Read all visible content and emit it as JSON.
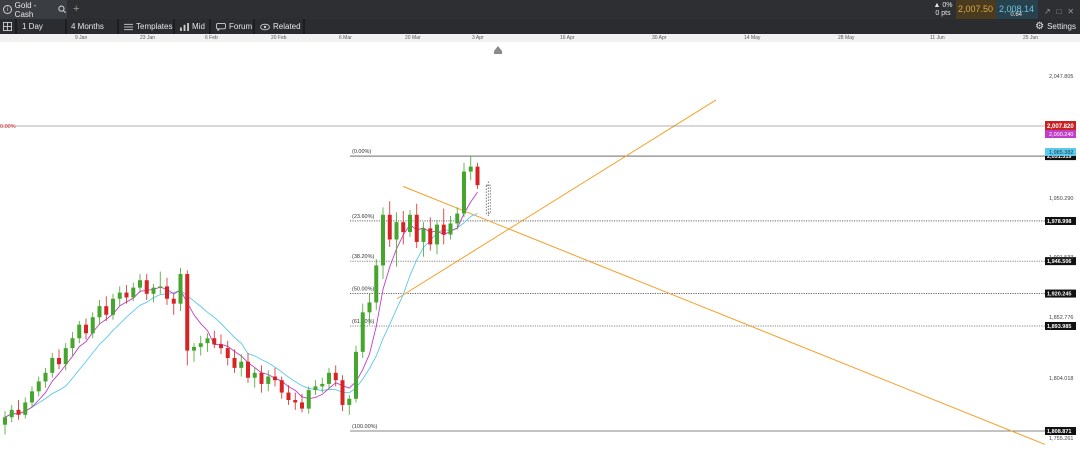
{
  "header": {
    "instrument_tab": "Gold - Cash",
    "icons": {
      "instrument": "info-circle-icon",
      "search": "search-icon",
      "add_tab": "plus-icon",
      "settings": "gear-icon"
    }
  },
  "quote": {
    "change_label": "▲ 0%",
    "change_points": "0 pts",
    "bid": "2,007.50",
    "spread": "0.64",
    "ask": "2,008.14",
    "colors": {
      "bid": "#d9a84a",
      "ask": "#6fc3e0"
    }
  },
  "toolbar": {
    "interval": "1 Day",
    "period": "4 Months",
    "templates": "Templates",
    "mid": "Mid",
    "forum": "Forum",
    "related": "Related",
    "settings": "Settings"
  },
  "time_axis": [
    "9 Jan",
    "23 Jan",
    "6 Feb",
    "20 Feb",
    "6 Mar",
    "20 Mar",
    "3 Apr",
    "16 Apr",
    "30 Apr",
    "14 May",
    "28 May",
    "11 Jun",
    "25 Jun"
  ],
  "chart_data": {
    "type": "candlestick",
    "instrument": "Gold - Cash",
    "interval": "1 Day",
    "y_axis_ticks": [
      "2,047.805",
      "1,950.290",
      "1,901.533",
      "1,852.776",
      "1,804.018",
      "1,755.261"
    ],
    "fib_labels": [
      "(0.00%)",
      "(23.60%)",
      "(38.20%)",
      "(50.00%)",
      "(61.80%)",
      "(100.00%)"
    ],
    "fib_badges": [
      "2,031.519",
      "1,978.998",
      "1,946.506",
      "1,920.245",
      "1,893.985",
      "1,808.871"
    ],
    "current_price": "2,007.820",
    "ma_price_1": "2,000.240",
    "ma_price_2": "1,985.382",
    "left_stub_label": "0.00%",
    "colors": {
      "up": "#45a52c",
      "down": "#d62424",
      "ma_fast": "#c03fc8",
      "ma_slow": "#5bc8ec",
      "trendline": "#f4a028"
    },
    "candles": [
      [
        1814,
        1825,
        1806,
        1820
      ],
      [
        1820,
        1830,
        1816,
        1826
      ],
      [
        1826,
        1834,
        1818,
        1822
      ],
      [
        1822,
        1836,
        1819,
        1832
      ],
      [
        1832,
        1845,
        1828,
        1841
      ],
      [
        1841,
        1853,
        1837,
        1849
      ],
      [
        1849,
        1860,
        1844,
        1856
      ],
      [
        1856,
        1872,
        1852,
        1868
      ],
      [
        1868,
        1875,
        1859,
        1863
      ],
      [
        1863,
        1880,
        1858,
        1876
      ],
      [
        1876,
        1889,
        1870,
        1884
      ],
      [
        1884,
        1898,
        1880,
        1895
      ],
      [
        1895,
        1900,
        1883,
        1888
      ],
      [
        1888,
        1905,
        1884,
        1901
      ],
      [
        1901,
        1915,
        1895,
        1910
      ],
      [
        1910,
        1918,
        1898,
        1903
      ],
      [
        1903,
        1920,
        1899,
        1916
      ],
      [
        1916,
        1926,
        1910,
        1921
      ],
      [
        1921,
        1927,
        1912,
        1917
      ],
      [
        1917,
        1929,
        1914,
        1925
      ],
      [
        1925,
        1936,
        1921,
        1931
      ],
      [
        1931,
        1936,
        1915,
        1920
      ],
      [
        1920,
        1928,
        1913,
        1925
      ],
      [
        1925,
        1938,
        1920,
        1926
      ],
      [
        1926,
        1933,
        1911,
        1916
      ],
      [
        1916,
        1920,
        1903,
        1912
      ],
      [
        1912,
        1941,
        1906,
        1936
      ],
      [
        1936,
        1939,
        1862,
        1874
      ],
      [
        1874,
        1880,
        1865,
        1877
      ],
      [
        1877,
        1886,
        1870,
        1880
      ],
      [
        1880,
        1888,
        1873,
        1884
      ],
      [
        1884,
        1890,
        1876,
        1879
      ],
      [
        1879,
        1887,
        1871,
        1876
      ],
      [
        1876,
        1882,
        1862,
        1868
      ],
      [
        1868,
        1875,
        1856,
        1860
      ],
      [
        1860,
        1871,
        1853,
        1865
      ],
      [
        1865,
        1872,
        1848,
        1852
      ],
      [
        1852,
        1860,
        1844,
        1856
      ],
      [
        1856,
        1862,
        1840,
        1847
      ],
      [
        1847,
        1858,
        1841,
        1853
      ],
      [
        1853,
        1860,
        1845,
        1850
      ],
      [
        1850,
        1853,
        1835,
        1840
      ],
      [
        1840,
        1846,
        1830,
        1834
      ],
      [
        1834,
        1840,
        1826,
        1832
      ],
      [
        1832,
        1839,
        1824,
        1827
      ],
      [
        1827,
        1845,
        1823,
        1842
      ],
      [
        1842,
        1850,
        1838,
        1845
      ],
      [
        1845,
        1852,
        1840,
        1847
      ],
      [
        1847,
        1860,
        1843,
        1856
      ],
      [
        1856,
        1862,
        1845,
        1850
      ],
      [
        1850,
        1854,
        1825,
        1830
      ],
      [
        1830,
        1838,
        1822,
        1835
      ],
      [
        1835,
        1878,
        1832,
        1873
      ],
      [
        1873,
        1912,
        1868,
        1905
      ],
      [
        1905,
        1920,
        1895,
        1913
      ],
      [
        1913,
        1948,
        1907,
        1943
      ],
      [
        1943,
        1990,
        1932,
        1984
      ],
      [
        1984,
        1995,
        1958,
        1964
      ],
      [
        1964,
        1986,
        1942,
        1978
      ],
      [
        1978,
        1987,
        1960,
        1970
      ],
      [
        1970,
        1988,
        1966,
        1984
      ],
      [
        1984,
        1993,
        1957,
        1962
      ],
      [
        1962,
        1978,
        1950,
        1973
      ],
      [
        1973,
        1982,
        1955,
        1960
      ],
      [
        1960,
        1980,
        1952,
        1976
      ],
      [
        1976,
        1989,
        1960,
        1968
      ],
      [
        1968,
        1983,
        1964,
        1977
      ],
      [
        1977,
        1990,
        1972,
        1985
      ],
      [
        1985,
        2026,
        1982,
        2019
      ],
      [
        2019,
        2031,
        2012,
        2023
      ],
      [
        2023,
        2026,
        2005,
        2008
      ]
    ],
    "forecast_candle": [
      2008,
      2011,
      1982,
      1985
    ]
  }
}
